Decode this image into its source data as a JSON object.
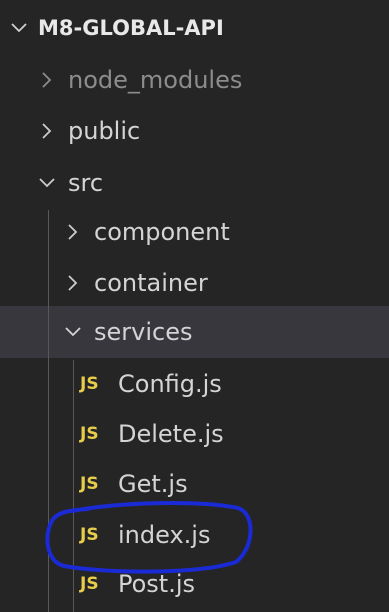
{
  "explorer": {
    "project_title": "M8-GLOBAL-API",
    "items": [
      {
        "label": "node_modules",
        "kind": "folder",
        "expanded": false,
        "dimmed": true
      },
      {
        "label": "public",
        "kind": "folder",
        "expanded": false
      },
      {
        "label": "src",
        "kind": "folder",
        "expanded": true
      },
      {
        "label": "component",
        "kind": "folder",
        "expanded": false
      },
      {
        "label": "container",
        "kind": "folder",
        "expanded": false
      },
      {
        "label": "services",
        "kind": "folder",
        "expanded": true,
        "selected": true
      },
      {
        "label": "Config.js",
        "kind": "file",
        "icon_text": "JS"
      },
      {
        "label": "Delete.js",
        "kind": "file",
        "icon_text": "JS"
      },
      {
        "label": "Get.js",
        "kind": "file",
        "icon_text": "JS"
      },
      {
        "label": "index.js",
        "kind": "file",
        "icon_text": "JS",
        "annotated": true
      },
      {
        "label": "Post.js",
        "kind": "file",
        "icon_text": "JS"
      }
    ]
  },
  "colors": {
    "background": "#252526",
    "selected_row": "#37373d",
    "js_icon": "#e8cd4a",
    "annotation": "#1a2bd6"
  }
}
